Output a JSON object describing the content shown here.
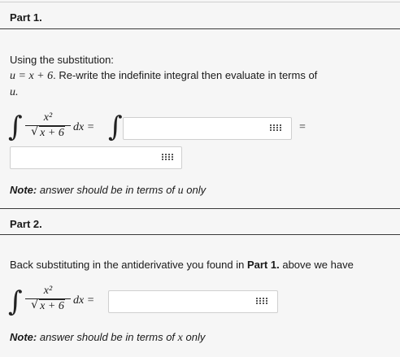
{
  "part1": {
    "header": "Part 1.",
    "intro_line1": "Using the substitution:",
    "sub_eq": "u = x + 6",
    "intro_line2_rest": ". Re-write the indefinite integral then evaluate in terms of",
    "intro_line3": "u.",
    "integrand_num": "x²",
    "integrand_den": "x + 6",
    "dx_equals": "dx =",
    "equals": "=",
    "input1_value": "",
    "input2_value": "",
    "note_label": "Note:",
    "note_text": "answer should be in terms of",
    "note_var": "u",
    "note_tail": "only"
  },
  "part2": {
    "header": "Part 2.",
    "intro_text": "Back substituting in the antiderivative you found in",
    "intro_bold": "Part 1.",
    "intro_tail": "above we have",
    "integrand_num": "x²",
    "integrand_den": "x + 6",
    "dx_equals": "dx =",
    "input_value": "",
    "note_label": "Note:",
    "note_text": "answer should be in terms of",
    "note_var": "x",
    "note_tail": "only"
  },
  "icons": {
    "palette": "math-palette-icon"
  }
}
